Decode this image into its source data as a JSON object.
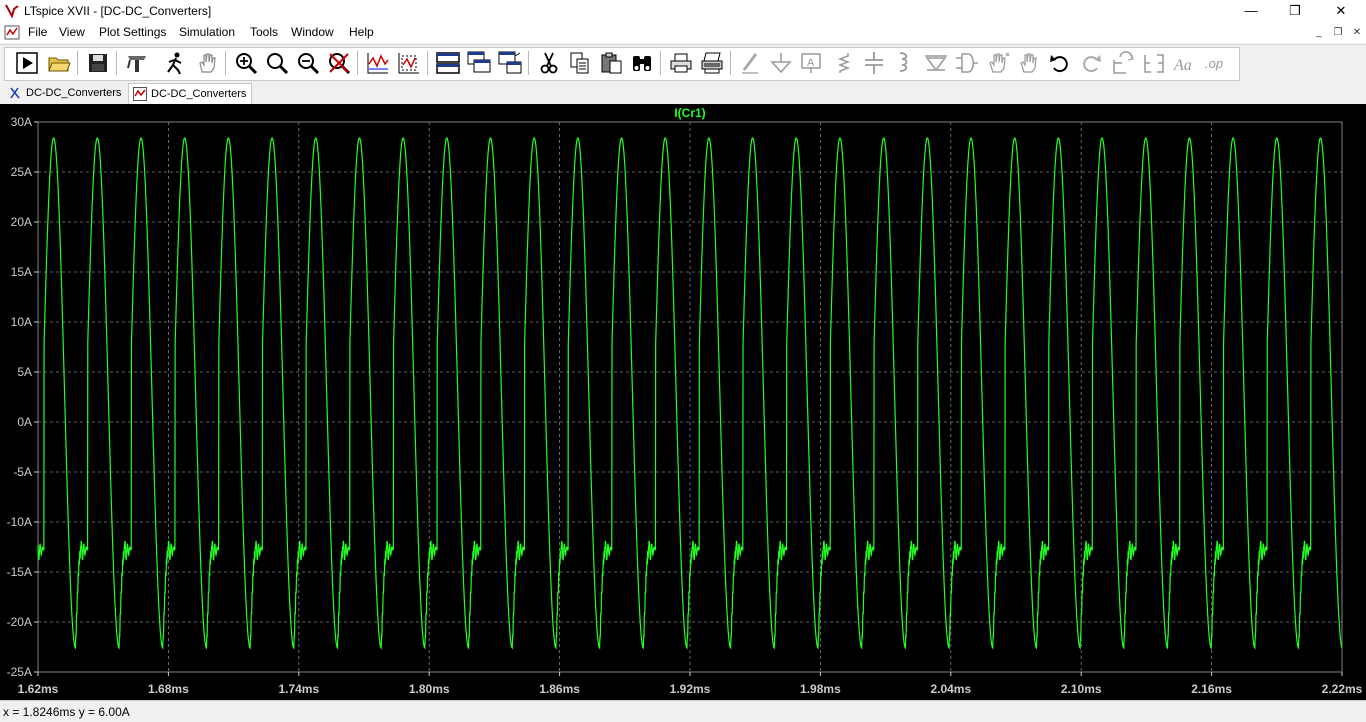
{
  "window": {
    "title": "LTspice XVII - [DC-DC_Converters]",
    "minimize_glyph": "—",
    "restore_glyph": "❐",
    "close_glyph": "✕",
    "mdi_minimize_glyph": "_",
    "mdi_restore_glyph": "❐",
    "mdi_close_glyph": "✕"
  },
  "menu": {
    "items": [
      "File",
      "View",
      "Plot Settings",
      "Simulation",
      "Tools",
      "Window",
      "Help"
    ]
  },
  "toolbar": {
    "buttons": [
      "run-icon",
      "open-folder-icon",
      "save-icon",
      "control-panel-icon",
      "run-man-icon",
      "pan-hand-icon",
      "zoom-in-icon",
      "zoom-area-icon",
      "zoom-out-icon",
      "zoom-cancel-icon",
      "autorange-icon",
      "autorange-y-icon",
      "tile-horizontal-icon",
      "cascade-icon",
      "tile-vertical-icon",
      "cut-icon",
      "copy-icon",
      "paste-icon",
      "find-icon",
      "print-icon",
      "print-setup-icon",
      "draw-wire-icon",
      "ground-icon",
      "label-net-icon",
      "resistor-icon",
      "capacitor-icon",
      "inductor-icon",
      "diode-icon",
      "component-icon",
      "move-icon",
      "drag-icon",
      "undo-icon",
      "redo-icon",
      "rotate-icon",
      "mirror-icon",
      "text-icon",
      "spice-directive-icon"
    ]
  },
  "tabs": [
    {
      "label": "DC-DC_Converters",
      "icon": "schematic-icon",
      "active": false
    },
    {
      "label": "DC-DC_Converters",
      "icon": "waveform-icon",
      "active": true
    }
  ],
  "status": {
    "cursor_readout": "x = 1.8246ms   y = 6.00A"
  },
  "colors": {
    "trace": "#22ff22",
    "plot_background": "#000000",
    "grid": "#808080",
    "axis_text": "#cccccc"
  },
  "chart_data": {
    "type": "line",
    "title": "I(Cr1)",
    "xlabel": "",
    "ylabel": "",
    "xlim": [
      1.62,
      2.22
    ],
    "ylim": [
      -25,
      30
    ],
    "x_ticks": [
      "1.62ms",
      "1.68ms",
      "1.74ms",
      "1.80ms",
      "1.86ms",
      "1.92ms",
      "1.98ms",
      "2.04ms",
      "2.10ms",
      "2.16ms",
      "2.22ms"
    ],
    "y_ticks": [
      "30A",
      "25A",
      "20A",
      "15A",
      "10A",
      "5A",
      "0A",
      "-5A",
      "-10A",
      "-15A",
      "-20A",
      "-25A"
    ],
    "grid": true,
    "series": [
      {
        "name": "I(Cr1)",
        "period_ms": 0.0201,
        "phase_ms": 1.6272,
        "max": 28.4,
        "min": -22.6,
        "shoulder": -13.0,
        "x_start_ms": 1.62,
        "x_end_ms": 2.22
      }
    ]
  }
}
